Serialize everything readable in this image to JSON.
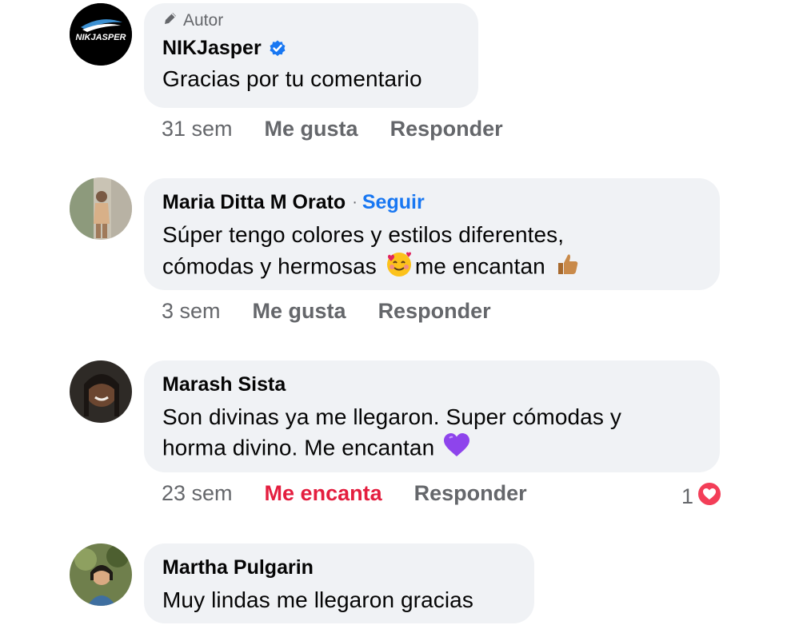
{
  "comments": [
    {
      "author": "NIKJasper",
      "avatar_text": "NIKJASPER",
      "author_badge": "Autor",
      "verified": true,
      "text_lines": [
        "Gracias por tu comentario"
      ],
      "time": "31 sem",
      "like_label": "Me gusta",
      "reply_label": "Responder"
    },
    {
      "author": "Maria Ditta M Orato",
      "follow_label": "Seguir",
      "separator": "·",
      "text_lines": [
        "Súper tengo colores y estilos diferentes,",
        "cómodas y hermosas",
        "me encantan"
      ],
      "time": "3 sem",
      "like_label": "Me gusta",
      "reply_label": "Responder"
    },
    {
      "author": "Marash Sista",
      "text_lines": [
        "Son divinas ya me llegaron. Super cómodas y",
        "horma divino. Me encantan"
      ],
      "time": "23 sem",
      "like_label": "Me encanta",
      "reply_label": "Responder",
      "reaction_count": "1"
    },
    {
      "author": "Martha Pulgarin",
      "text_lines": [
        "Muy lindas me llegaron gracias"
      ]
    }
  ],
  "colors": {
    "bubble": "#f0f2f5",
    "secondary_text": "#65676b",
    "link_blue": "#1877f2",
    "love_red": "#e41e3f"
  },
  "icons": [
    "pencil-icon",
    "verified-badge-icon",
    "smiling-face-with-hearts-emoji",
    "thumbs-up-emoji",
    "purple-heart-emoji",
    "love-reaction-icon"
  ]
}
